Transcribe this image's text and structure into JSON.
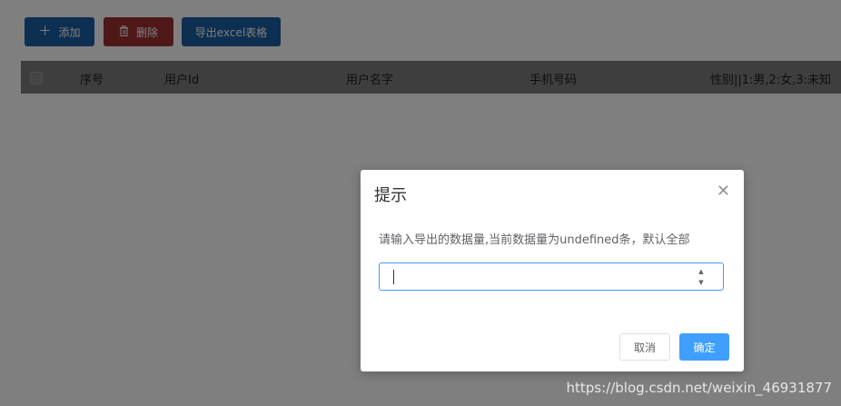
{
  "toolbar": {
    "add_label": "添加",
    "delete_label": "删除",
    "export_label": "导出excel表格"
  },
  "table": {
    "headers": [
      "序号",
      "用户Id",
      "用户名字",
      "手机号码",
      "性别||1:男,2:女,3:未知"
    ]
  },
  "dialog": {
    "title": "提示",
    "message": "请输入导出的数据量,当前数据量为undefined条，默认全部",
    "input_value": "",
    "cancel_label": "取消",
    "confirm_label": "确定"
  },
  "watermark": "https://blog.csdn.net/weixin_46931877",
  "colors": {
    "primary": "#409eff",
    "danger": "#f56c6c"
  }
}
